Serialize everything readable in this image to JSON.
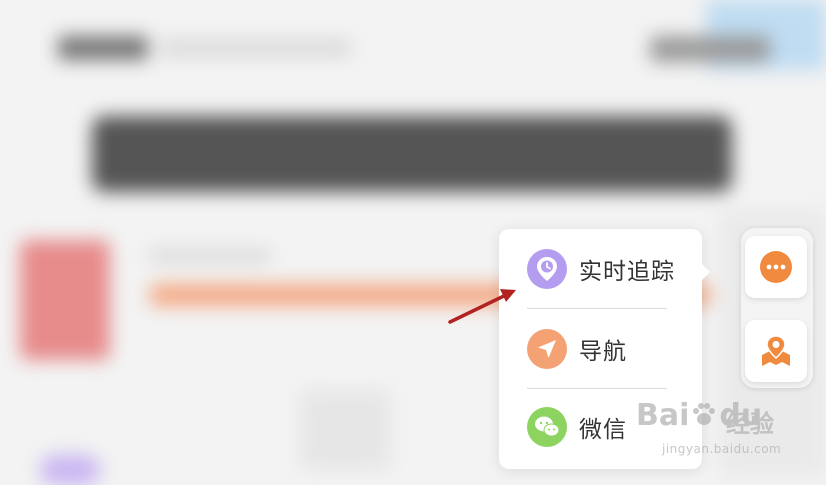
{
  "menu": {
    "items": [
      {
        "label": "实时追踪",
        "icon": "clock-location-icon",
        "color": "#b49cf0"
      },
      {
        "label": "导航",
        "icon": "navigation-arrow-icon",
        "color": "#f4a173"
      },
      {
        "label": "微信",
        "icon": "wechat-icon",
        "color": "#8cd35f"
      }
    ]
  },
  "floating_buttons": [
    {
      "icon": "more-icon",
      "color": "#f08a3e"
    },
    {
      "icon": "map-pin-icon",
      "color": "#f08a3e"
    }
  ],
  "watermark": {
    "brand": "Bai",
    "brand2": "du",
    "suffix": "经验",
    "url": "jingyan.baidu.com"
  },
  "colors": {
    "annotation_arrow": "#b22222",
    "accent": "#f08a3e"
  }
}
